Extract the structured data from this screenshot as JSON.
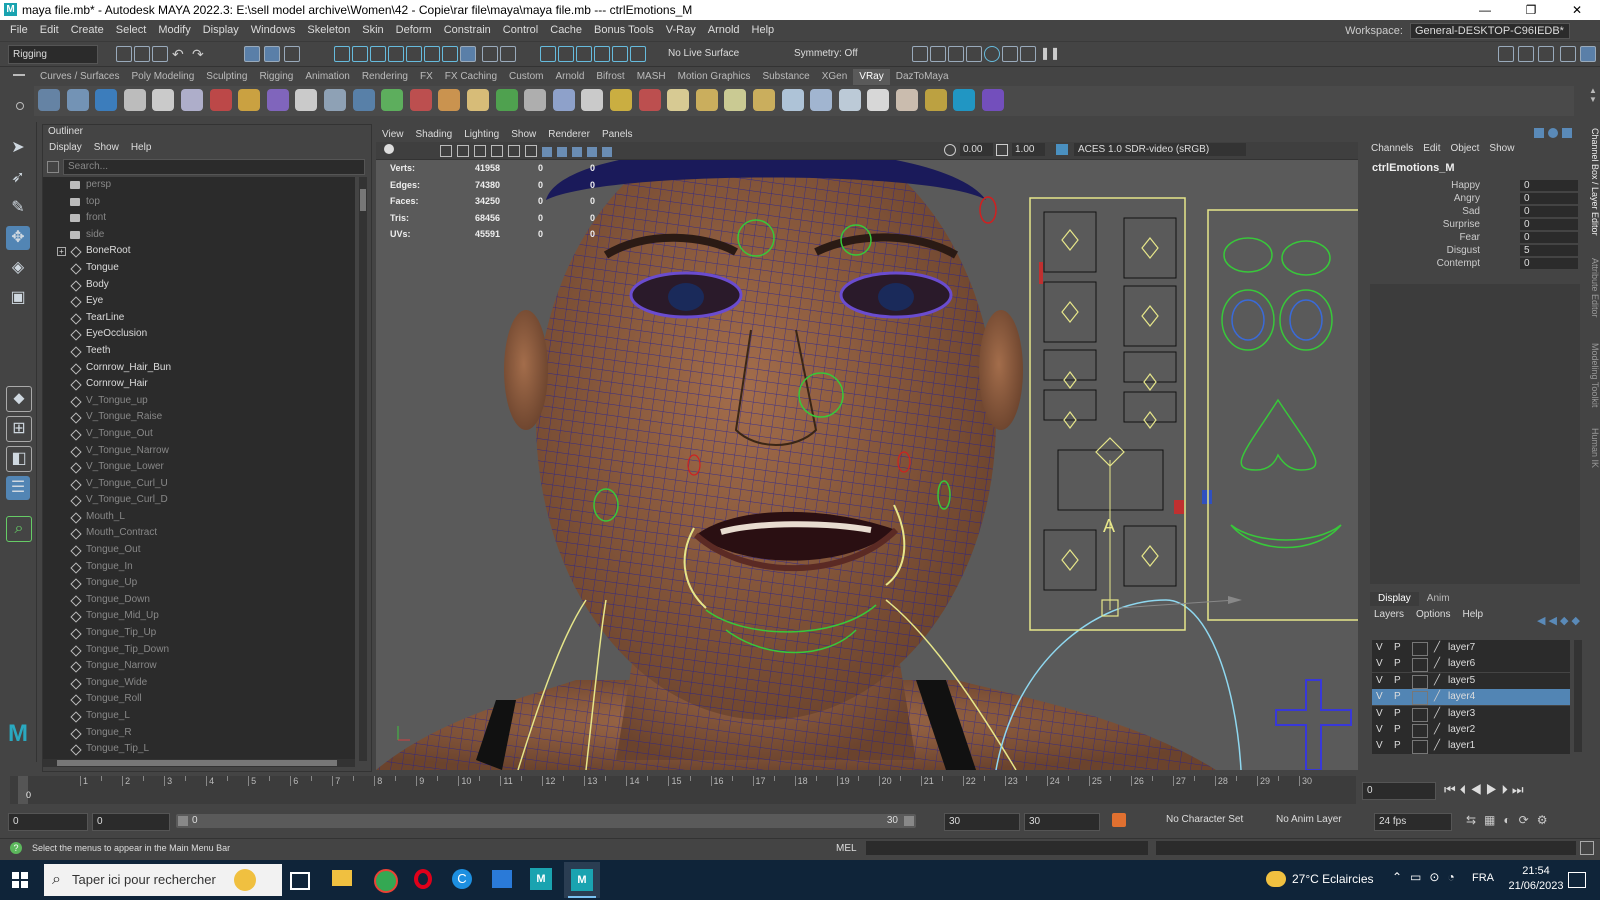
{
  "window": {
    "title": "maya file.mb* - Autodesk MAYA 2022.3: E:\\sell model archive\\Women\\42 - Copie\\rar file\\maya\\maya file.mb   ---   ctrlEmotions_M",
    "app_icon": "M"
  },
  "menubar": {
    "items": [
      "File",
      "Edit",
      "Create",
      "Select",
      "Modify",
      "Display",
      "Windows",
      "Skeleton",
      "Skin",
      "Deform",
      "Constrain",
      "Control",
      "Cache",
      "Bonus Tools",
      "V-Ray",
      "Arnold",
      "Help"
    ],
    "workspace_label": "Workspace:",
    "workspace_value": "General-DESKTOP-C96IEDB*"
  },
  "statusline": {
    "menu_set": "Rigging",
    "live_surface": "No Live Surface",
    "symmetry": "Symmetry: Off"
  },
  "shelf": {
    "tabs": [
      "Curves / Surfaces",
      "Poly Modeling",
      "Sculpting",
      "Rigging",
      "Animation",
      "Rendering",
      "FX",
      "FX Caching",
      "Custom",
      "Arnold",
      "Bifrost",
      "MASH",
      "Motion Graphics",
      "Substance",
      "XGen",
      "VRay",
      "DazToMaya"
    ],
    "active_tab": "VRay"
  },
  "outliner": {
    "title": "Outliner",
    "menu": [
      "Display",
      "Show",
      "Help"
    ],
    "search_placeholder": "Search...",
    "items": [
      {
        "label": "persp",
        "type": "cam",
        "dim": true
      },
      {
        "label": "top",
        "type": "cam",
        "dim": true
      },
      {
        "label": "front",
        "type": "cam",
        "dim": true
      },
      {
        "label": "side",
        "type": "cam",
        "dim": true
      },
      {
        "label": "BoneRoot",
        "type": "jnt",
        "dim": false,
        "expand": true
      },
      {
        "label": "Tongue",
        "type": "jnt",
        "dim": false
      },
      {
        "label": "Body",
        "type": "jnt",
        "dim": false
      },
      {
        "label": "Eye",
        "type": "jnt",
        "dim": false
      },
      {
        "label": "TearLine",
        "type": "jnt",
        "dim": false
      },
      {
        "label": "EyeOcclusion",
        "type": "jnt",
        "dim": false
      },
      {
        "label": "Teeth",
        "type": "jnt",
        "dim": false
      },
      {
        "label": "Cornrow_Hair_Bun",
        "type": "jnt",
        "dim": false
      },
      {
        "label": "Cornrow_Hair",
        "type": "jnt",
        "dim": false
      },
      {
        "label": "V_Tongue_up",
        "type": "jnt",
        "dim": true
      },
      {
        "label": "V_Tongue_Raise",
        "type": "jnt",
        "dim": true
      },
      {
        "label": "V_Tongue_Out",
        "type": "jnt",
        "dim": true
      },
      {
        "label": "V_Tongue_Narrow",
        "type": "jnt",
        "dim": true
      },
      {
        "label": "V_Tongue_Lower",
        "type": "jnt",
        "dim": true
      },
      {
        "label": "V_Tongue_Curl_U",
        "type": "jnt",
        "dim": true
      },
      {
        "label": "V_Tongue_Curl_D",
        "type": "jnt",
        "dim": true
      },
      {
        "label": "Mouth_L",
        "type": "jnt",
        "dim": true
      },
      {
        "label": "Mouth_Contract",
        "type": "jnt",
        "dim": true
      },
      {
        "label": "Tongue_Out",
        "type": "jnt",
        "dim": true
      },
      {
        "label": "Tongue_In",
        "type": "jnt",
        "dim": true
      },
      {
        "label": "Tongue_Up",
        "type": "jnt",
        "dim": true
      },
      {
        "label": "Tongue_Down",
        "type": "jnt",
        "dim": true
      },
      {
        "label": "Tongue_Mid_Up",
        "type": "jnt",
        "dim": true
      },
      {
        "label": "Tongue_Tip_Up",
        "type": "jnt",
        "dim": true
      },
      {
        "label": "Tongue_Tip_Down",
        "type": "jnt",
        "dim": true
      },
      {
        "label": "Tongue_Narrow",
        "type": "jnt",
        "dim": true
      },
      {
        "label": "Tongue_Wide",
        "type": "jnt",
        "dim": true
      },
      {
        "label": "Tongue_Roll",
        "type": "jnt",
        "dim": true
      },
      {
        "label": "Tongue_L",
        "type": "jnt",
        "dim": true
      },
      {
        "label": "Tongue_R",
        "type": "jnt",
        "dim": true
      },
      {
        "label": "Tongue_Tip_L",
        "type": "jnt",
        "dim": true
      }
    ]
  },
  "viewport": {
    "menu": [
      "View",
      "Shading",
      "Lighting",
      "Show",
      "Renderer",
      "Panels"
    ],
    "exposure": "0.00",
    "gamma": "1.00",
    "color_space": "ACES 1.0 SDR-video (sRGB)",
    "hud": [
      {
        "k": "Verts:",
        "v": "41958",
        "a": "0",
        "b": "0"
      },
      {
        "k": "Edges:",
        "v": "74380",
        "a": "0",
        "b": "0"
      },
      {
        "k": "Faces:",
        "v": "34250",
        "a": "0",
        "b": "0"
      },
      {
        "k": "Tris:",
        "v": "68456",
        "a": "0",
        "b": "0"
      },
      {
        "k": "UVs:",
        "v": "45591",
        "a": "0",
        "b": "0"
      }
    ]
  },
  "channelbox": {
    "menu": [
      "Channels",
      "Edit",
      "Object",
      "Show"
    ],
    "object": "ctrlEmotions_M",
    "attrs": [
      {
        "k": "Happy",
        "v": "0"
      },
      {
        "k": "Angry",
        "v": "0"
      },
      {
        "k": "Sad",
        "v": "0"
      },
      {
        "k": "Surprise",
        "v": "0"
      },
      {
        "k": "Fear",
        "v": "0"
      },
      {
        "k": "Disgust",
        "v": "5"
      },
      {
        "k": "Contempt",
        "v": "0"
      }
    ],
    "side_tabs": [
      "Channel Box / Layer Editor",
      "Attribute Editor",
      "Modeling Toolkit",
      "Human IK"
    ]
  },
  "layers": {
    "tabs": [
      "Display",
      "Anim"
    ],
    "menu": [
      "Layers",
      "Options",
      "Help"
    ],
    "rows": [
      {
        "v": "V",
        "p": "P",
        "name": "layer7",
        "sel": false
      },
      {
        "v": "V",
        "p": "P",
        "name": "layer6",
        "sel": false
      },
      {
        "v": "V",
        "p": "P",
        "name": "layer5",
        "sel": false
      },
      {
        "v": "V",
        "p": "P",
        "name": "layer4",
        "sel": true
      },
      {
        "v": "V",
        "p": "P",
        "name": "layer3",
        "sel": false
      },
      {
        "v": "V",
        "p": "P",
        "name": "layer2",
        "sel": false
      },
      {
        "v": "V",
        "p": "P",
        "name": "layer1",
        "sel": false
      }
    ]
  },
  "timeline": {
    "ticks": [
      "1",
      "2",
      "3",
      "4",
      "5",
      "6",
      "7",
      "8",
      "9",
      "10",
      "11",
      "12",
      "13",
      "14",
      "15",
      "16",
      "17",
      "18",
      "19",
      "20",
      "21",
      "22",
      "23",
      "24",
      "25",
      "26",
      "27",
      "28",
      "29",
      "30"
    ],
    "current_frame": "0",
    "start_label": "0"
  },
  "range": {
    "start": "0",
    "start2": "0",
    "slider_left": "0",
    "slider_right": "30",
    "end": "30",
    "end2": "30",
    "character_set": "No Character Set",
    "anim_layer": "No Anim Layer",
    "fps": "24 fps"
  },
  "helpline": {
    "text": "Select the menus to appear in the Main Menu Bar",
    "mel": "MEL"
  },
  "taskbar": {
    "search_placeholder": "Taper ici pour rechercher",
    "weather": "27°C  Eclaircies",
    "lang": "FRA",
    "time": "21:54",
    "date": "21/06/2023"
  },
  "colors": {
    "accent": "#5285b4",
    "wire": "#1a1a9a",
    "control_yellow": "#e6e68a",
    "control_green": "#38c83a"
  }
}
